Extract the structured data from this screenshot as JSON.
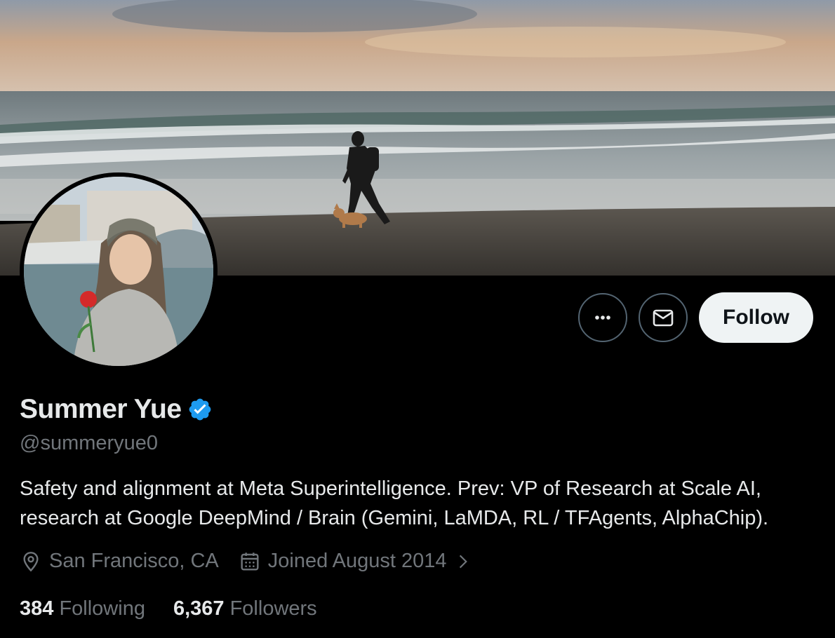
{
  "profile": {
    "display_name": "Summer Yue",
    "handle": "@summeryue0",
    "bio_line1": "Safety and alignment at Meta Superintelligence. Prev: VP of Research at Scale AI,",
    "bio_line2": "research at Google DeepMind / Brain (Gemini, LaMDA, RL / TFAgents, AlphaChip).",
    "location": "San Francisco, CA",
    "joined": "Joined August 2014",
    "following_count": "384",
    "following_label": "Following",
    "followers_count": "6,367",
    "followers_label": "Followers"
  },
  "actions": {
    "follow_label": "Follow",
    "more_icon": "more-icon",
    "message_icon": "mail-icon"
  },
  "icons": {
    "verified": "verified-badge-icon",
    "location": "location-pin-icon",
    "calendar": "calendar-icon",
    "chevron": "chevron-right-icon"
  },
  "colors": {
    "background": "#000000",
    "text_primary": "#e7e9ea",
    "text_secondary": "#71767b",
    "verified_blue": "#1d9bf0",
    "follow_bg": "#eff3f4",
    "border": "#536471"
  }
}
